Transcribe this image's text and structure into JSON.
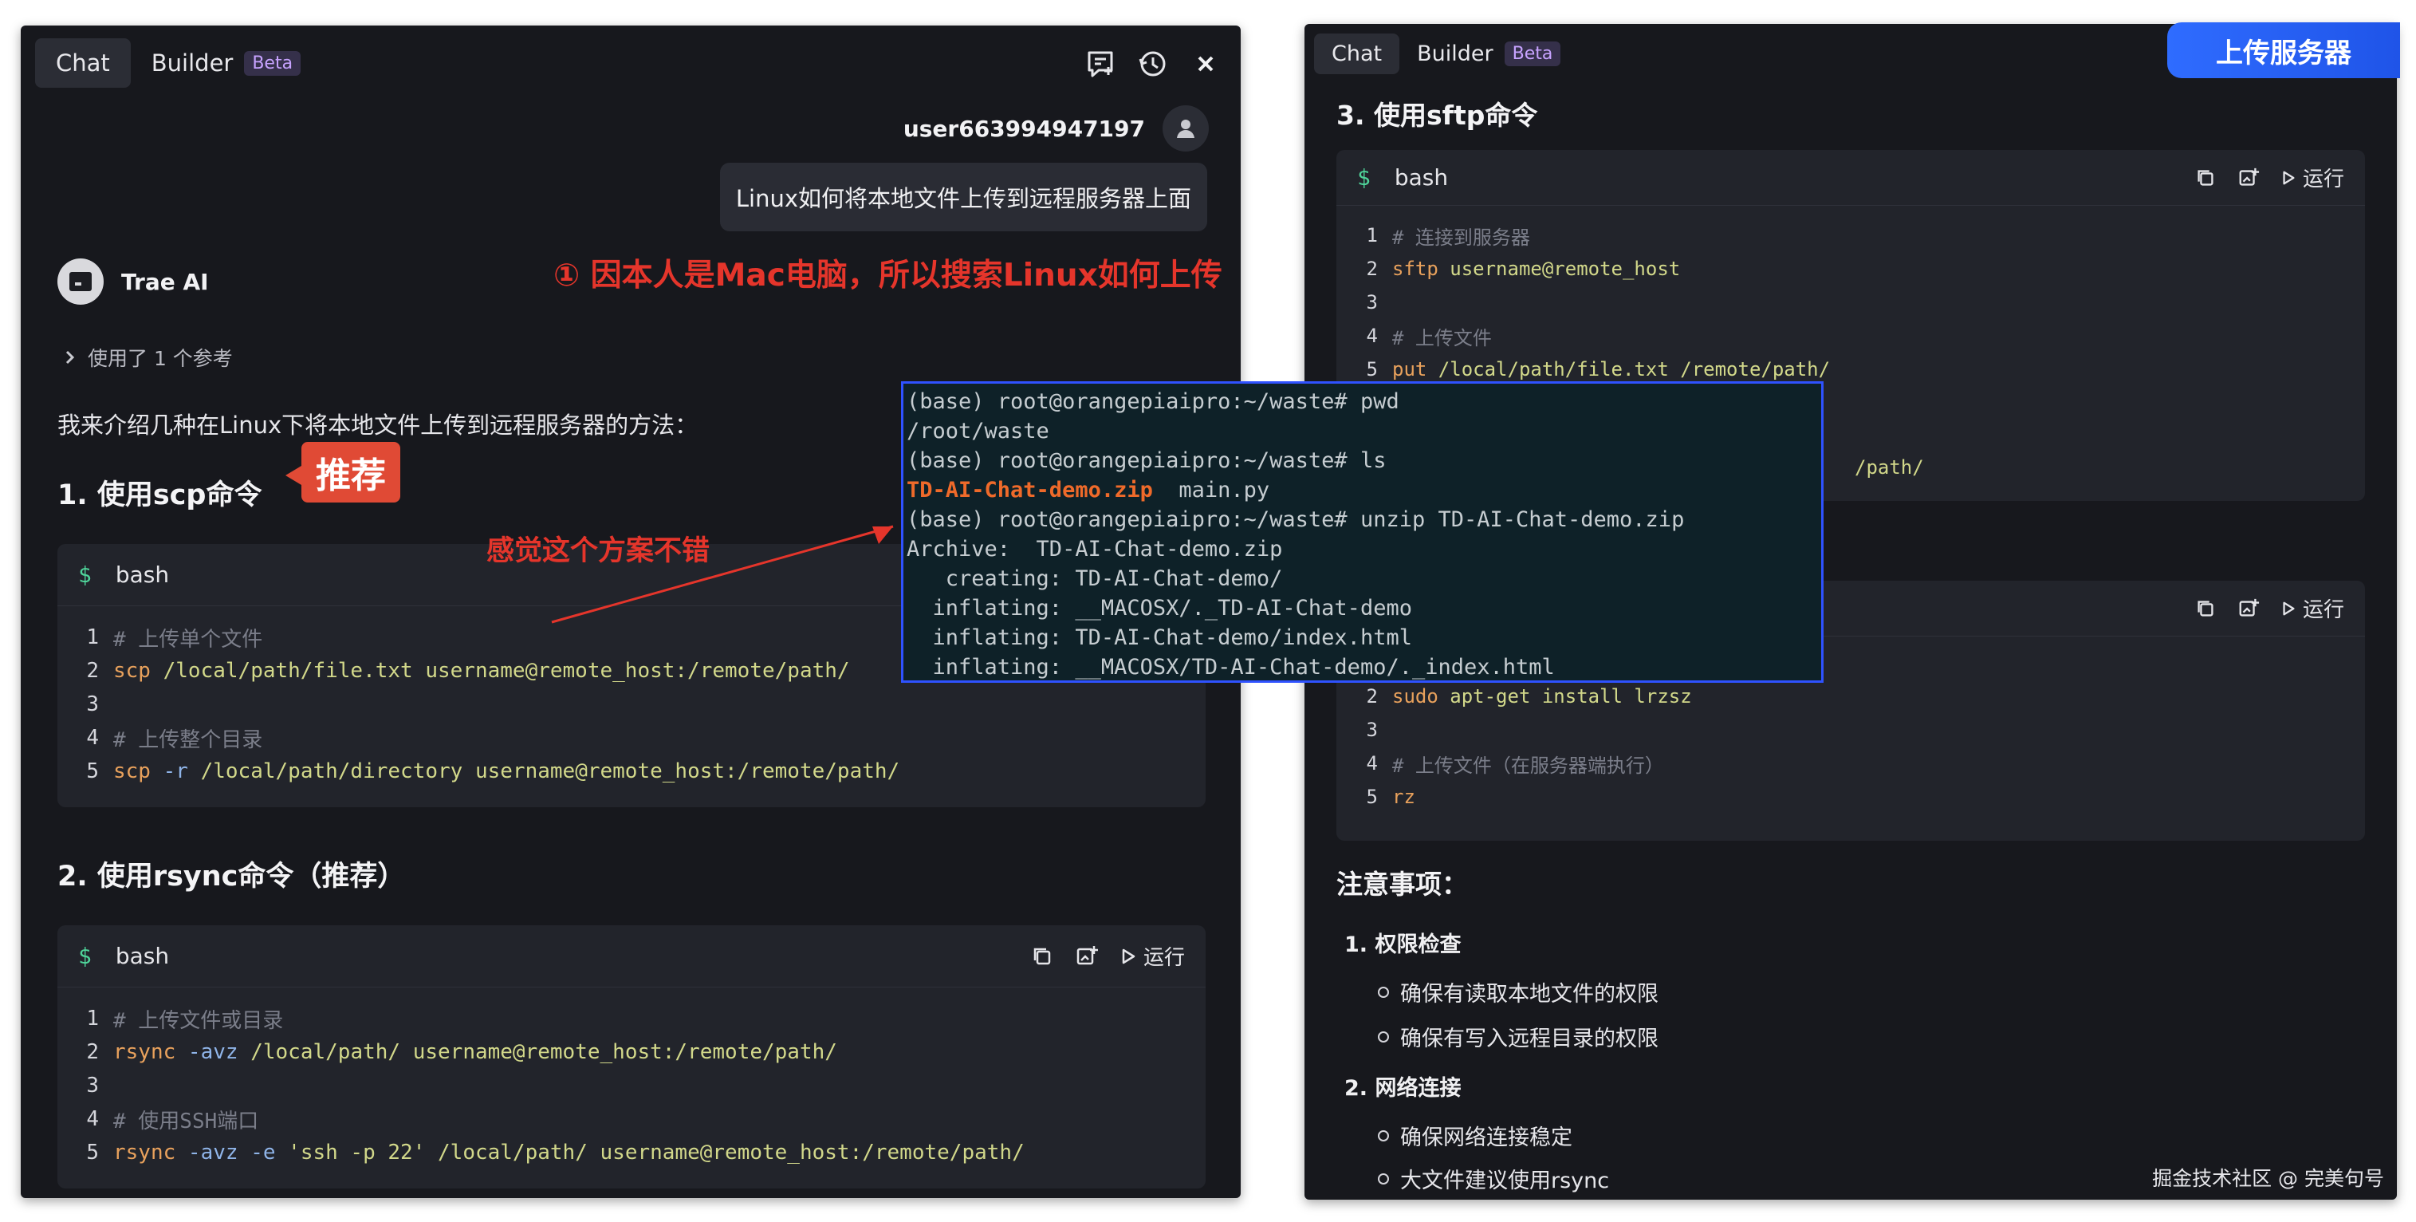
{
  "tabs": {
    "chat": "Chat",
    "builder": "Builder",
    "beta": "Beta"
  },
  "user": {
    "name": "user663994947197"
  },
  "question": "Linux如何将本地文件上传到远程服务器上面",
  "ai": {
    "name": "Trae AI",
    "ref": "使用了 1 个参考"
  },
  "intro": "我来介绍几种在Linux下将本地文件上传到远程服务器的方法：",
  "sections": {
    "scp": {
      "title": "1. 使用scp命令",
      "lang": "bash",
      "lines": [
        {
          "n": "1",
          "comment": "# 上传单个文件"
        },
        {
          "n": "2",
          "cmd": "scp",
          "rest": " /local/path/file.txt username@remote_host:/remote/path/"
        },
        {
          "n": "3"
        },
        {
          "n": "4",
          "comment": "# 上传整个目录"
        },
        {
          "n": "5",
          "cmd": "scp",
          "flag": " -r",
          "rest": " /local/path/directory username@remote_host:/remote/path/"
        }
      ]
    },
    "rsync": {
      "title": "2. 使用rsync命令（推荐）",
      "lang": "bash",
      "lines": [
        {
          "n": "1",
          "comment": "# 上传文件或目录"
        },
        {
          "n": "2",
          "cmd": "rsync",
          "flag": " -avz",
          "rest": " /local/path/ username@remote_host:/remote/path/"
        },
        {
          "n": "3"
        },
        {
          "n": "4",
          "comment": "# 使用SSH端口"
        },
        {
          "n": "5",
          "cmd": "rsync",
          "flag": " -avz -e",
          "str": " 'ssh -p 22'",
          "rest": " /local/path/ username@remote_host:/remote/path/"
        }
      ]
    },
    "sftp": {
      "title": "3. 使用sftp命令",
      "lang": "bash",
      "lines": [
        {
          "n": "1",
          "comment": "# 连接到服务器"
        },
        {
          "n": "2",
          "cmd": "sftp",
          "rest": " username@remote_host"
        },
        {
          "n": "3"
        },
        {
          "n": "4",
          "comment": "# 上传文件"
        },
        {
          "n": "5",
          "cmd": "put",
          "rest": " /local/path/file.txt /remote/path/"
        }
      ],
      "hidden_tail": "/path/"
    },
    "rz": {
      "lang": "bash",
      "lines": [
        {
          "n": "2",
          "cmd": "sudo",
          "rest": " apt-get install lrzsz"
        },
        {
          "n": "3"
        },
        {
          "n": "4",
          "comment": "# 上传文件（在服务器端执行）"
        },
        {
          "n": "5",
          "cmd": "rz"
        }
      ]
    }
  },
  "run_label": "运行",
  "annotations": {
    "note1": "①  因本人是Mac电脑，所以搜索Linux如何上传",
    "recommend": "推荐",
    "feeling": "感觉这个方案不错"
  },
  "terminal": {
    "lines": [
      "(base) root@orangepiaipro:~/waste# pwd",
      "/root/waste",
      "(base) root@orangepiaipro:~/waste# ls",
      "TD-AI-Chat-demo.zip|  main.py",
      "(base) root@orangepiaipro:~/waste# unzip TD-AI-Chat-demo.zip",
      "Archive:  TD-AI-Chat-demo.zip",
      "   creating: TD-AI-Chat-demo/",
      "  inflating: __MACOSX/._TD-AI-Chat-demo",
      "  inflating: TD-AI-Chat-demo/index.html",
      "  inflating: __MACOSX/TD-AI-Chat-demo/._index.html"
    ]
  },
  "upload_button": "上传服务器",
  "notes": {
    "title": "注意事项：",
    "items": [
      {
        "label": "1. 权限检查",
        "subs": [
          "确保有读取本地文件的权限",
          "确保有写入远程目录的权限"
        ]
      },
      {
        "label": "2. 网络连接",
        "subs": [
          "确保网络连接稳定",
          "大文件建议使用rsync"
        ]
      }
    ]
  },
  "watermark": "掘金技术社区 @ 完美句号",
  "colors": {
    "accent_red": "#e5352b",
    "terminal_border": "#2f52ff",
    "upload_blue": "#2f6cff"
  }
}
